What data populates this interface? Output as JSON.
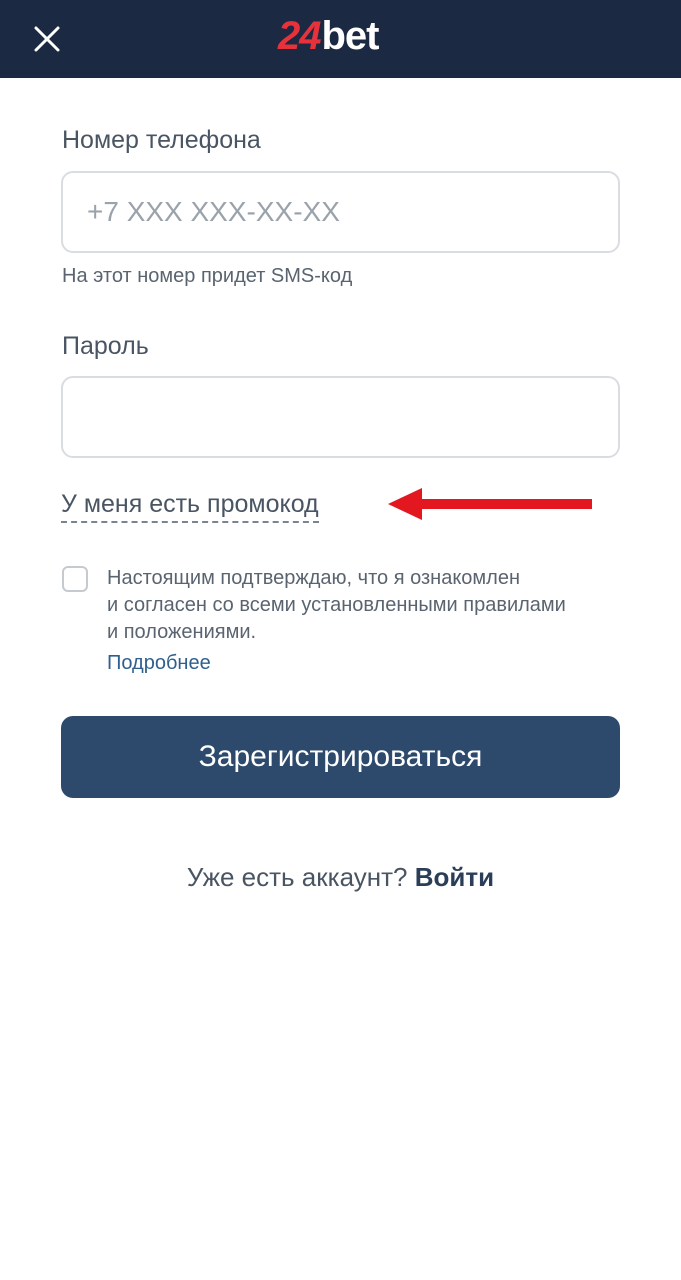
{
  "header": {
    "close_icon": "close-icon",
    "logo_number": "24",
    "logo_word": "bet"
  },
  "phone": {
    "label": "Номер телефона",
    "placeholder": "+7 XXX XXX-XX-XX",
    "value": "",
    "hint": "На этот номер придет SMS-код"
  },
  "password": {
    "label": "Пароль",
    "value": ""
  },
  "promo": {
    "label": "У меня есть промокод",
    "arrow_color": "#e3171f"
  },
  "terms": {
    "checked": false,
    "line1": "Настоящим подтверждаю, что я ознакомлен",
    "line2": "и согласен со всеми установленными правилами",
    "line3": "и положениями.",
    "more_link": "Подробнее"
  },
  "submit": {
    "label": "Зарегистрироваться"
  },
  "login": {
    "prompt": "Уже есть аккаунт?",
    "link": "Войти"
  },
  "colors": {
    "header_bg": "#1b2943",
    "logo_accent": "#e8323b",
    "button_bg": "#2d4a6d",
    "link": "#2f5f8f"
  }
}
